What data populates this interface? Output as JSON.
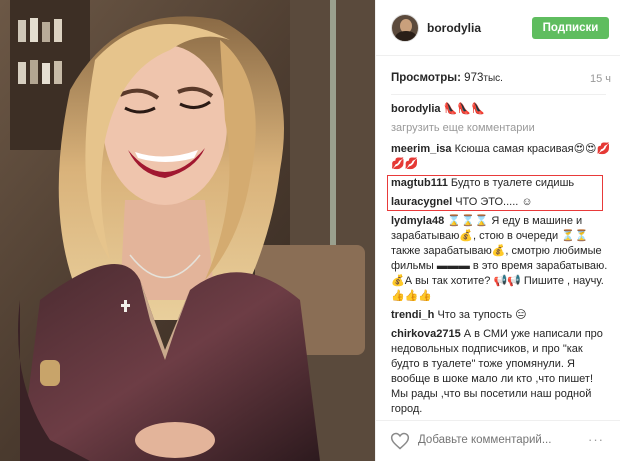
{
  "header": {
    "username": "borodylia",
    "follow_label": "Подписки"
  },
  "meta": {
    "views_label": "Просмотры:",
    "views_value": "973",
    "views_suffix": "тыс.",
    "time_ago": "15 ч"
  },
  "comments": {
    "caption_user": "borodylia",
    "caption_text": "👠👠👠",
    "load_more": "загрузить еще комментарии",
    "items": [
      {
        "user": "meerim_isa",
        "text": "Ксюша самая красивая😍😍💋💋💋"
      },
      {
        "user": "magtub111",
        "text": "Будто в туалете сидишь"
      },
      {
        "user": "lauracygnel",
        "text": "ЧТО ЭТО..... ☺"
      },
      {
        "user": "lydmyla48",
        "text": "⌛⌛⌛ Я еду в машине и зарабатываю💰, стою в очереди ⏳⏳ также зарабатываю💰, смотрю любимые фильмы ▬▬▬ в это время зарабатываю. 💰А вы так хотите? 📢📢 Пишите , научу.👍👍👍"
      },
      {
        "user": "trendi_h",
        "text": "Что за тупость 😑"
      },
      {
        "user": "chirkova2715",
        "text": "А в СМИ уже написали про недовольных подписчиков, и про \"как будто в туалете\" тоже упомянули. Я вообще в шоке мало ли кто ,что пишет! Мы рады ,что вы посетили наш родной город."
      }
    ]
  },
  "footer": {
    "add_comment_placeholder": "Добавьте комментарий...",
    "more_label": "···"
  },
  "icons": {
    "like": "heart-icon",
    "more": "ellipsis-icon"
  },
  "colors": {
    "follow_button": "#5fbd5f",
    "highlight_box": "#e83a3a"
  }
}
